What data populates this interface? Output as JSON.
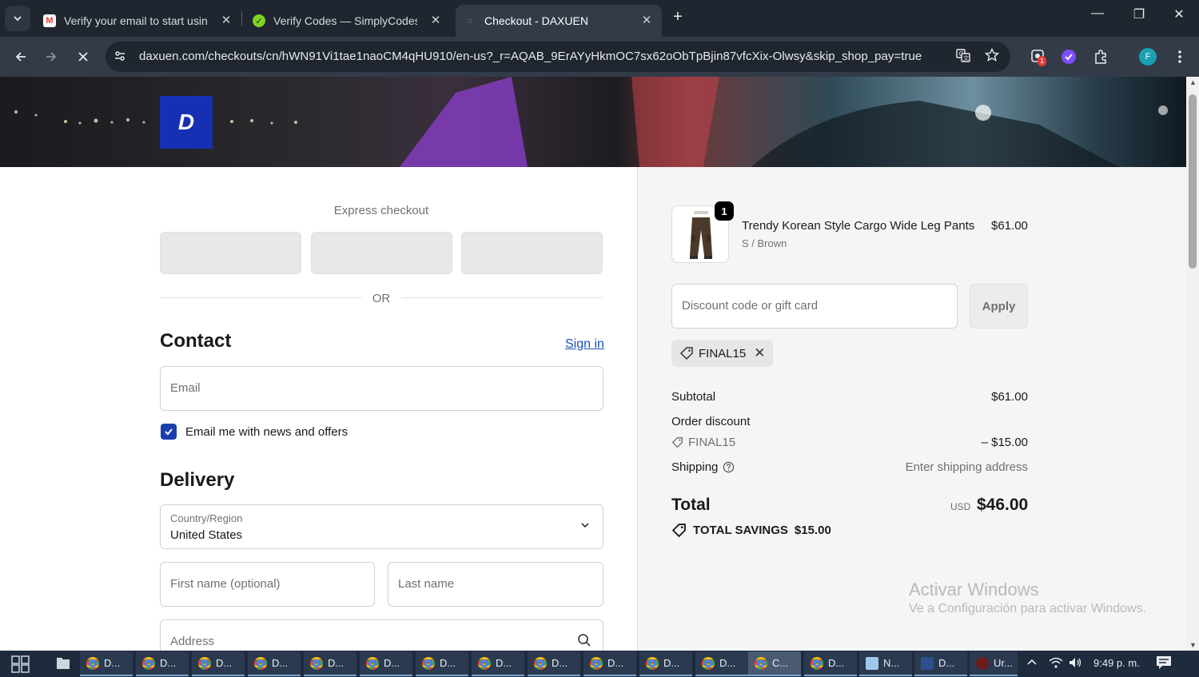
{
  "browser": {
    "tabs": [
      {
        "title": "Verify your email to start using",
        "icon": "gmail-icon"
      },
      {
        "title": "Verify Codes — SimplyCodes",
        "icon": "simplycodes-icon"
      },
      {
        "title": "Checkout - DAXUEN",
        "icon": "loading-icon"
      }
    ],
    "url": "daxuen.com/checkouts/cn/hWN91Vi1tae1naoCM4qHU910/en-us?_r=AQAB_9ErAYyHkmOC7sx62oObTpBjin87vfcXix-Olwsy&skip_shop_pay=true",
    "ext_badge": "1",
    "profile_initial": "F"
  },
  "store": {
    "logo_letter": "D",
    "colors": {
      "accent": "#1a3fae",
      "logo_bg": "#1730b3",
      "link": "#1a51b8"
    }
  },
  "checkout": {
    "express_title": "Express checkout",
    "or_text": "OR",
    "contact_heading": "Contact",
    "sign_in": "Sign in",
    "email_placeholder": "Email",
    "newsletter_label": "Email me with news and offers",
    "newsletter_checked": true,
    "delivery_heading": "Delivery",
    "country_label": "Country/Region",
    "country_value": "United States",
    "first_name_placeholder": "First name (optional)",
    "last_name_placeholder": "Last name",
    "address_placeholder": "Address"
  },
  "summary": {
    "item": {
      "quantity": "1",
      "name": "Trendy Korean Style Cargo Wide Leg Pants",
      "variant": "S / Brown",
      "price": "$61.00"
    },
    "discount_placeholder": "Discount code or gift card",
    "apply_label": "Apply",
    "applied_code": "FINAL15",
    "subtotal_label": "Subtotal",
    "subtotal_value": "$61.00",
    "order_discount_label": "Order discount",
    "discount_code": "FINAL15",
    "discount_value": "– $15.00",
    "shipping_label": "Shipping",
    "shipping_value": "Enter shipping address",
    "total_label": "Total",
    "currency": "USD",
    "total_value": "$46.00",
    "savings_label": "TOTAL SAVINGS",
    "savings_value": "$15.00"
  },
  "watermark": {
    "line1": "Activar Windows",
    "line2": "Ve a Configuración para activar Windows."
  },
  "taskbar": {
    "items": [
      "D...",
      "D...",
      "D...",
      "D...",
      "D...",
      "D...",
      "D...",
      "D...",
      "D...",
      "D...",
      "D...",
      "D...",
      "C...",
      "D...",
      "N...",
      "D...",
      "Ur..."
    ],
    "time": "9:49 p. m."
  }
}
